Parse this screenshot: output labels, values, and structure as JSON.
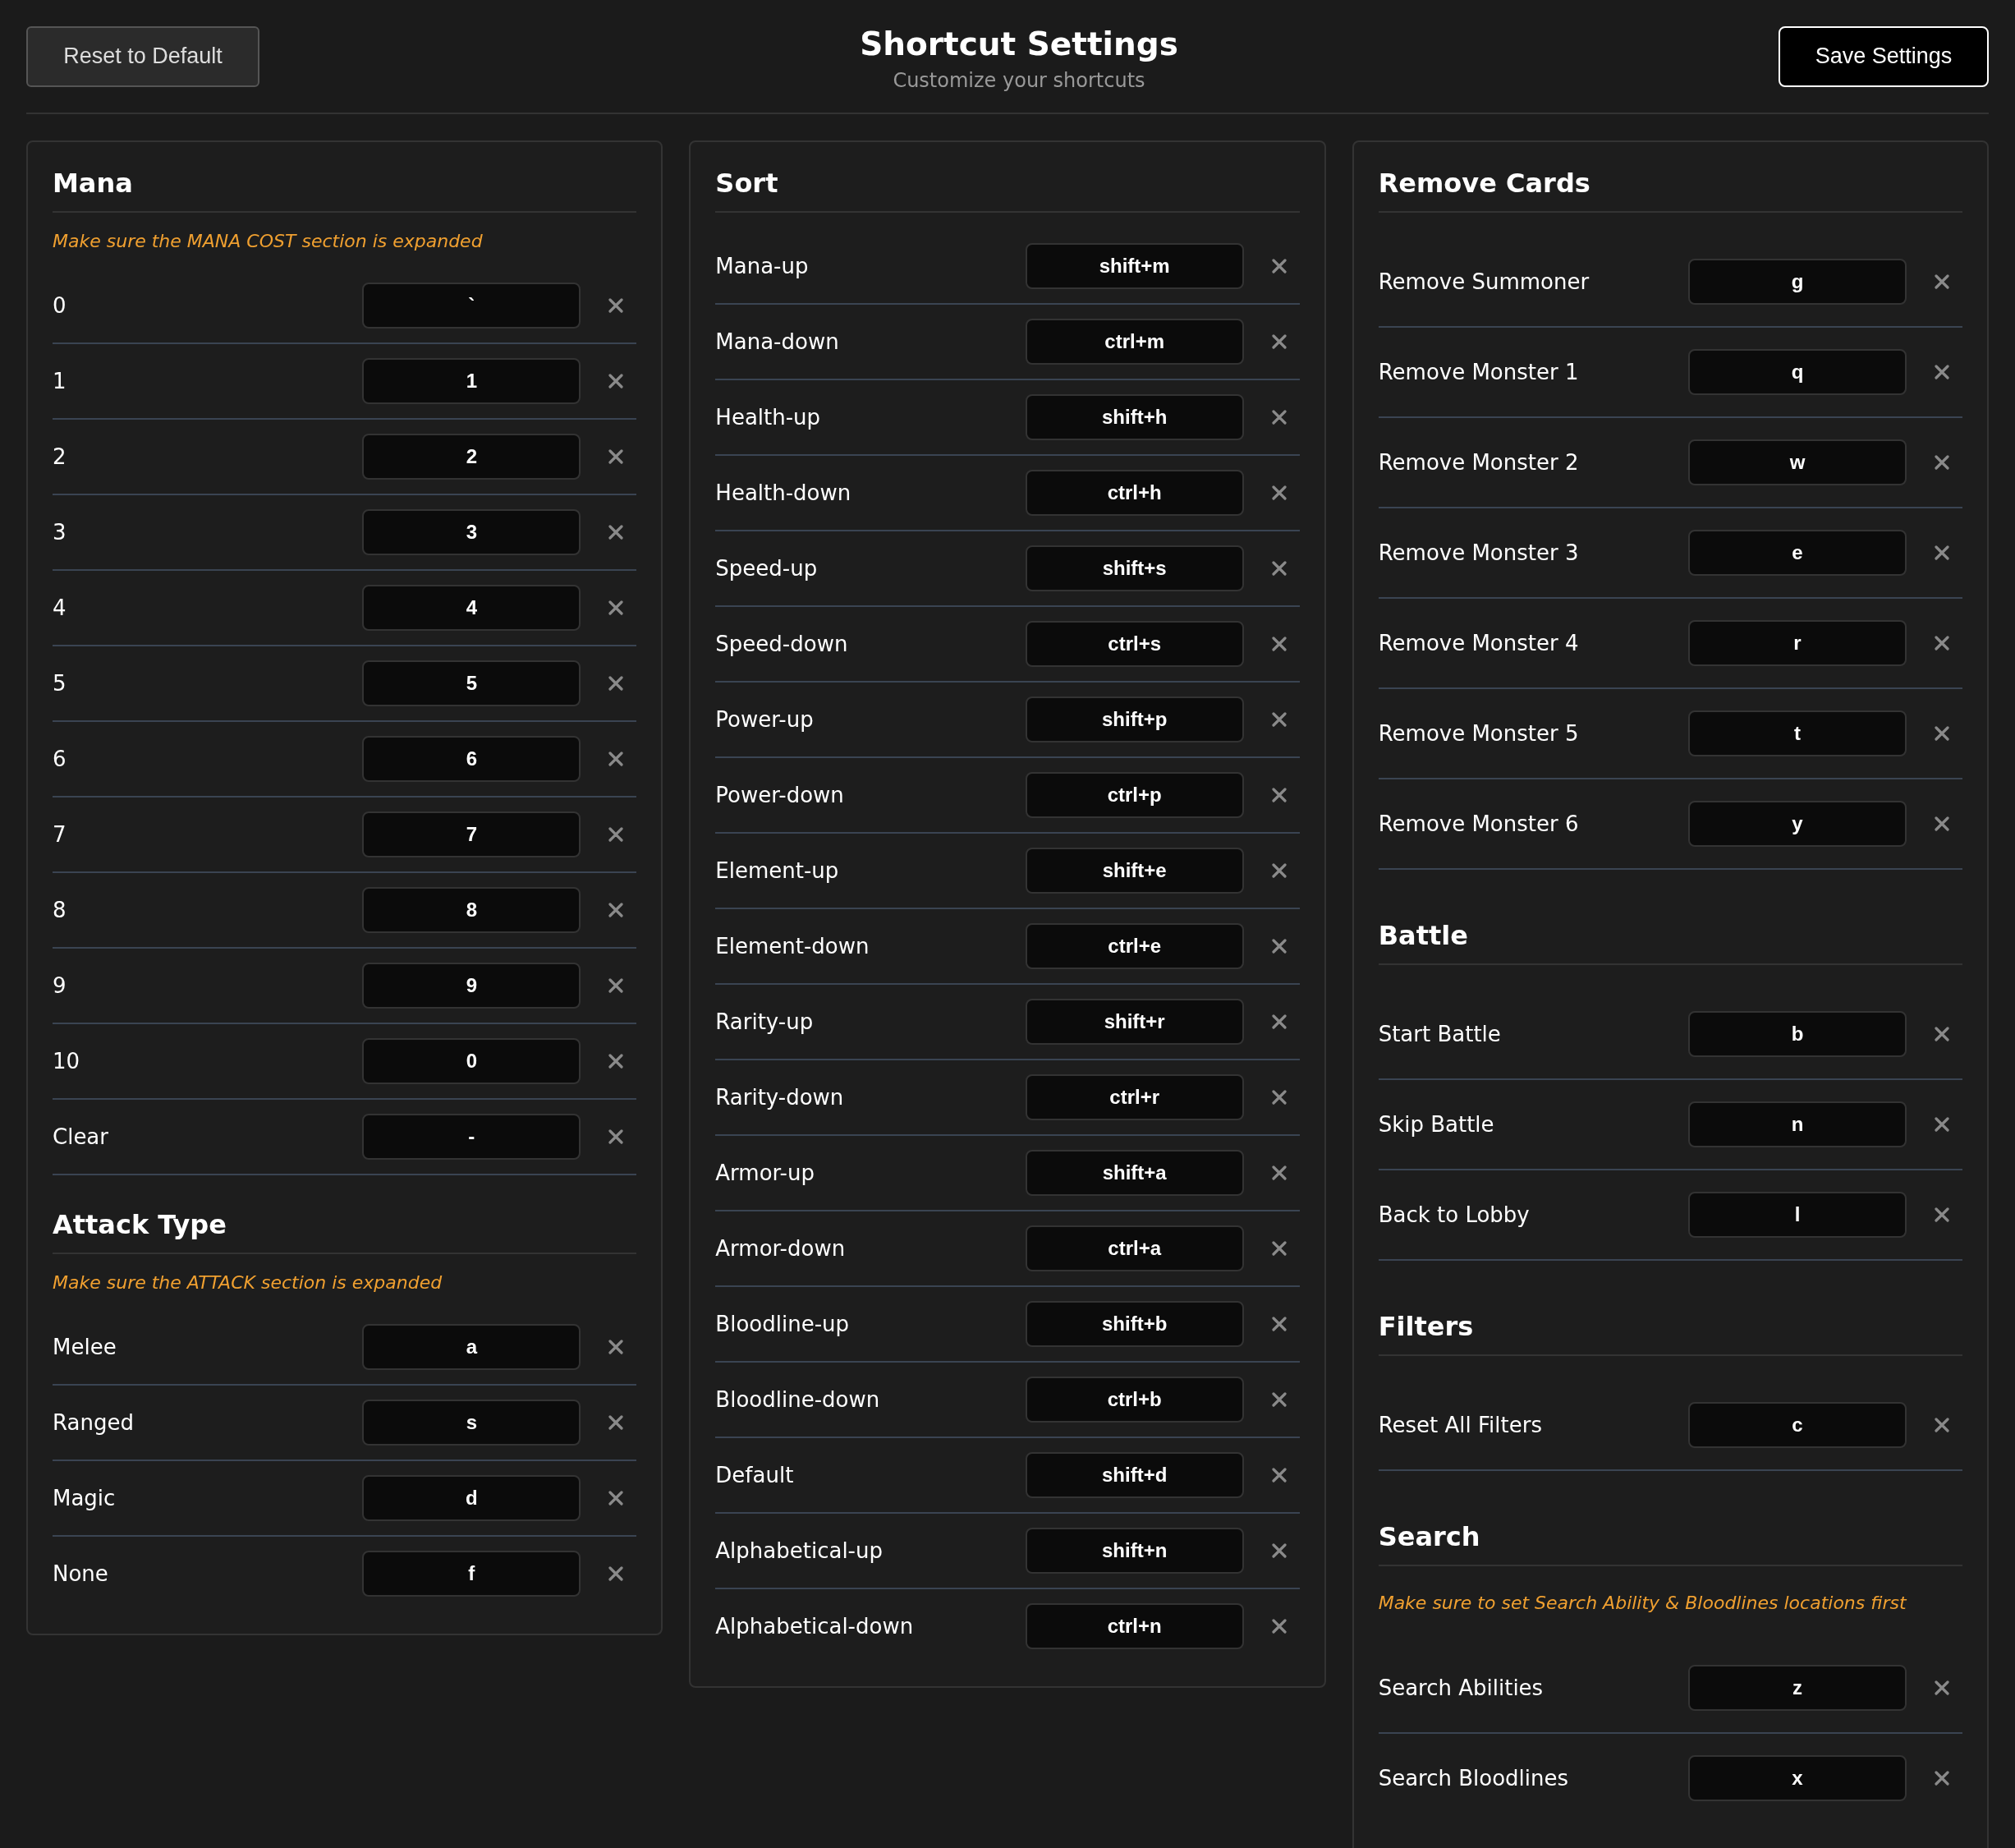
{
  "header": {
    "reset_button": "Reset to Default",
    "title": "Shortcut Settings",
    "subtitle": "Customize your shortcuts",
    "save_button": "Save Settings"
  },
  "columns": [
    {
      "sections": [
        {
          "title": "Mana",
          "note": "Make sure the MANA COST section is expanded",
          "shortcuts": [
            {
              "label": "0",
              "key": "`"
            },
            {
              "label": "1",
              "key": "1"
            },
            {
              "label": "2",
              "key": "2"
            },
            {
              "label": "3",
              "key": "3"
            },
            {
              "label": "4",
              "key": "4"
            },
            {
              "label": "5",
              "key": "5"
            },
            {
              "label": "6",
              "key": "6"
            },
            {
              "label": "7",
              "key": "7"
            },
            {
              "label": "8",
              "key": "8"
            },
            {
              "label": "9",
              "key": "9"
            },
            {
              "label": "10",
              "key": "0"
            },
            {
              "label": "Clear",
              "key": "-"
            }
          ]
        },
        {
          "title": "Attack Type",
          "note": "Make sure the ATTACK section is expanded",
          "shortcuts": [
            {
              "label": "Melee",
              "key": "a"
            },
            {
              "label": "Ranged",
              "key": "s"
            },
            {
              "label": "Magic",
              "key": "d"
            },
            {
              "label": "None",
              "key": "f"
            }
          ]
        }
      ]
    },
    {
      "sections": [
        {
          "title": "Sort",
          "shortcuts": [
            {
              "label": "Mana-up",
              "key": "shift+m"
            },
            {
              "label": "Mana-down",
              "key": "ctrl+m"
            },
            {
              "label": "Health-up",
              "key": "shift+h"
            },
            {
              "label": "Health-down",
              "key": "ctrl+h"
            },
            {
              "label": "Speed-up",
              "key": "shift+s"
            },
            {
              "label": "Speed-down",
              "key": "ctrl+s"
            },
            {
              "label": "Power-up",
              "key": "shift+p"
            },
            {
              "label": "Power-down",
              "key": "ctrl+p"
            },
            {
              "label": "Element-up",
              "key": "shift+e"
            },
            {
              "label": "Element-down",
              "key": "ctrl+e"
            },
            {
              "label": "Rarity-up",
              "key": "shift+r"
            },
            {
              "label": "Rarity-down",
              "key": "ctrl+r"
            },
            {
              "label": "Armor-up",
              "key": "shift+a"
            },
            {
              "label": "Armor-down",
              "key": "ctrl+a"
            },
            {
              "label": "Bloodline-up",
              "key": "shift+b"
            },
            {
              "label": "Bloodline-down",
              "key": "ctrl+b"
            },
            {
              "label": "Default",
              "key": "shift+d"
            },
            {
              "label": "Alphabetical-up",
              "key": "shift+n"
            },
            {
              "label": "Alphabetical-down",
              "key": "ctrl+n"
            }
          ]
        }
      ]
    },
    {
      "sections": [
        {
          "title": "Remove Cards",
          "shortcuts": [
            {
              "label": "Remove Summoner",
              "key": "g"
            },
            {
              "label": "Remove Monster 1",
              "key": "q"
            },
            {
              "label": "Remove Monster 2",
              "key": "w"
            },
            {
              "label": "Remove Monster 3",
              "key": "e"
            },
            {
              "label": "Remove Monster 4",
              "key": "r"
            },
            {
              "label": "Remove Monster 5",
              "key": "t"
            },
            {
              "label": "Remove Monster 6",
              "key": "y"
            }
          ]
        },
        {
          "title": "Battle",
          "shortcuts": [
            {
              "label": "Start Battle",
              "key": "b"
            },
            {
              "label": "Skip Battle",
              "key": "n"
            },
            {
              "label": "Back to Lobby",
              "key": "l"
            }
          ]
        },
        {
          "title": "Filters",
          "shortcuts": [
            {
              "label": "Reset All Filters",
              "key": "c"
            }
          ]
        },
        {
          "title": "Search",
          "note": "Make sure to set Search Ability & Bloodlines locations first",
          "shortcuts": [
            {
              "label": "Search Abilities",
              "key": "z"
            },
            {
              "label": "Search Bloodlines",
              "key": "x"
            }
          ]
        }
      ]
    }
  ]
}
